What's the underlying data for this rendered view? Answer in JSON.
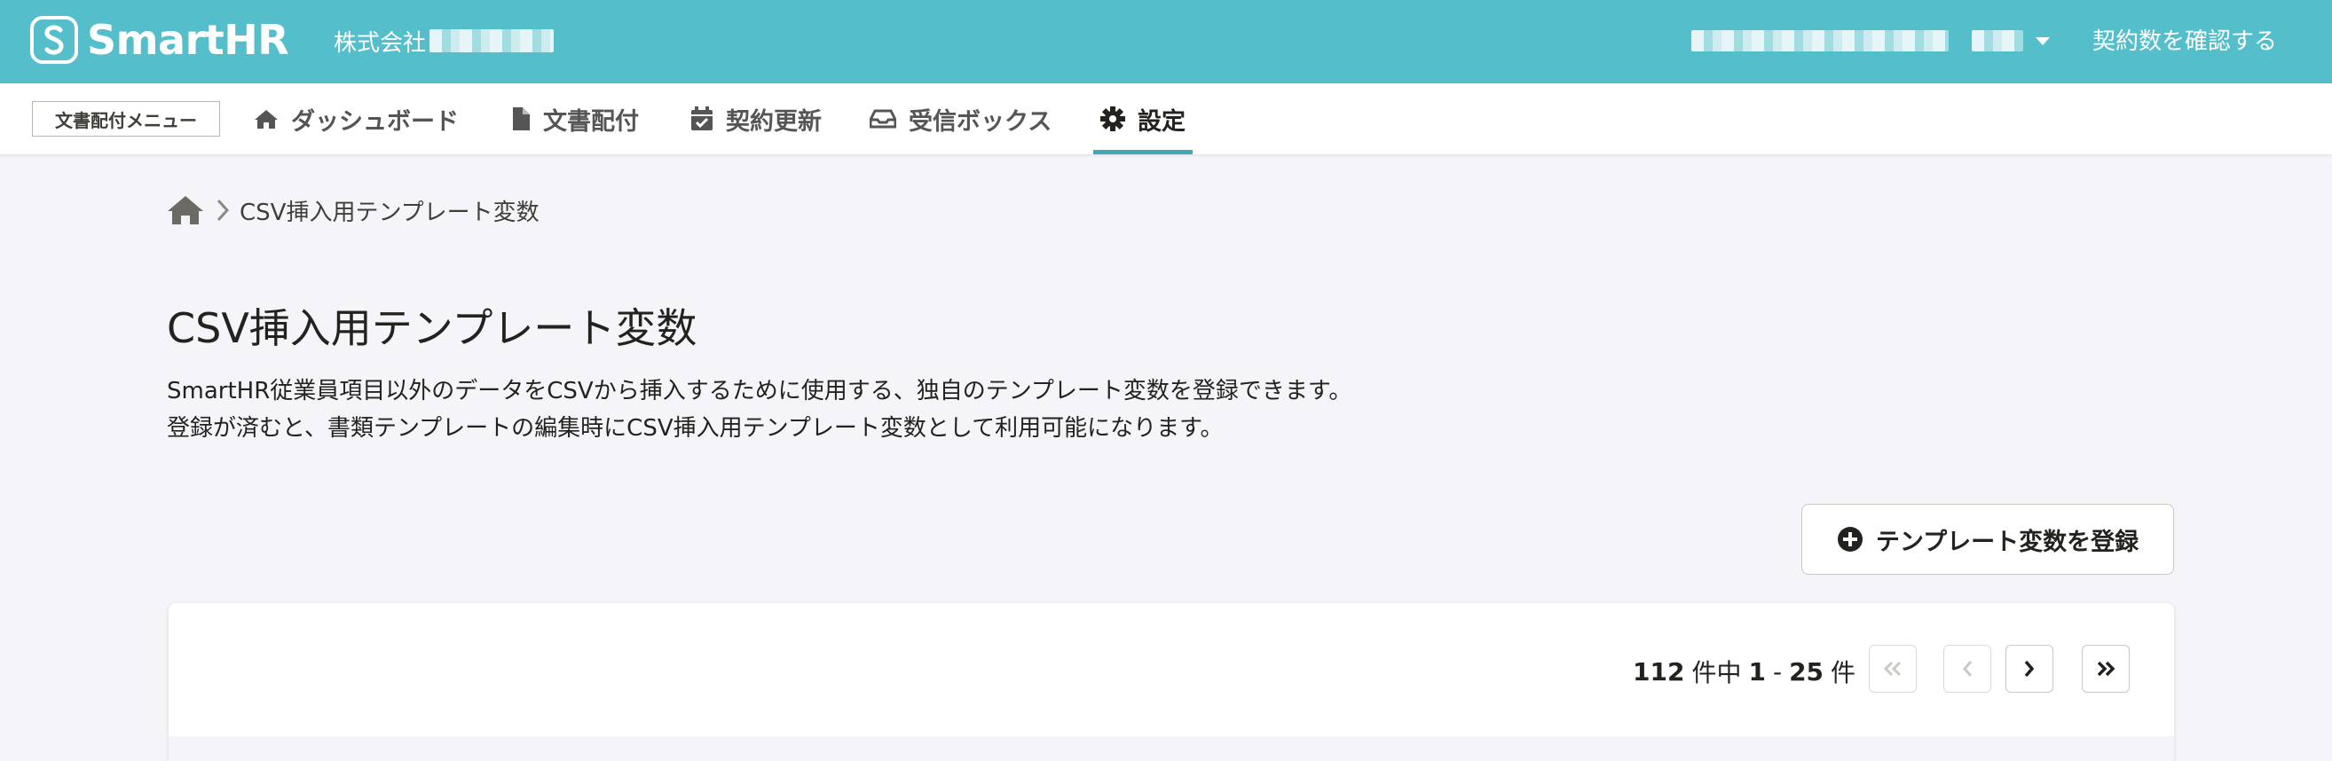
{
  "header": {
    "logo_text": "SmartHR",
    "company_prefix": "株式会社",
    "contract_link": "契約数を確認する",
    "bg_color": "#54bfca"
  },
  "subnav": {
    "menu_label": "文書配付メニュー",
    "items": [
      {
        "label": "ダッシュボード",
        "icon": "home-icon"
      },
      {
        "label": "文書配付",
        "icon": "document-icon"
      },
      {
        "label": "契約更新",
        "icon": "calendar-check-icon"
      },
      {
        "label": "受信ボックス",
        "icon": "inbox-icon"
      },
      {
        "label": "設定",
        "icon": "gear-icon",
        "active": true
      }
    ],
    "active_color": "#3fa8b3"
  },
  "breadcrumb": {
    "current": "CSV挿入用テンプレート変数"
  },
  "page": {
    "title": "CSV挿入用テンプレート変数",
    "description_line1": "SmartHR従業員項目以外のデータをCSVから挿入するために使用する、独自のテンプレート変数を登録できます。",
    "description_line2": "登録が済むと、書類テンプレートの編集時にCSV挿入用テンプレート変数として利用可能になります。",
    "register_button": "テンプレート変数を登録"
  },
  "pagination": {
    "total": "112",
    "total_suffix": "件中",
    "range_start": "1",
    "range_sep": "-",
    "range_end": "25",
    "range_suffix": "件"
  }
}
